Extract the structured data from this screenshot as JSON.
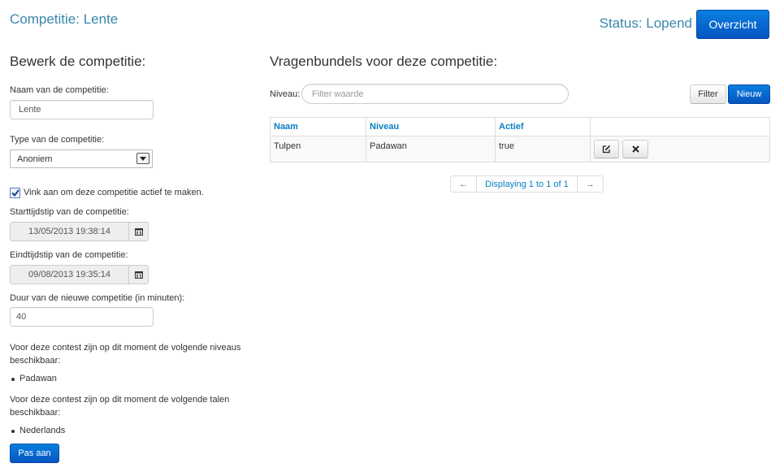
{
  "header": {
    "title": "Competitie: Lente",
    "status": "Status: Lopend",
    "overview_button": "Overzicht"
  },
  "form": {
    "heading": "Bewerk de competitie:",
    "name_label": "Naam van de competitie:",
    "name_value": "Lente",
    "type_label": "Type van de competitie:",
    "type_value": "Anoniem",
    "active_label": "Vink aan om deze competitie actief te maken.",
    "active_checked": true,
    "start_label": "Starttijdstip van de competitie:",
    "start_value": "13/05/2013 19:38:14",
    "end_label": "Eindtijdstip van de competitie:",
    "end_value": "09/08/2013 19:35:14",
    "duration_label": "Duur van de nieuwe competitie (in minuten):",
    "duration_value": "40",
    "levels_text": "Voor deze contest zijn op dit moment de volgende niveaus beschikbaar:",
    "levels": [
      "Padawan"
    ],
    "languages_text": "Voor deze contest zijn op dit moment de volgende talen beschikbaar:",
    "languages": [
      "Nederlands"
    ],
    "submit_button": "Pas aan"
  },
  "bundles": {
    "heading": "Vragenbundels voor deze competitie:",
    "filter_label": "Niveau:",
    "filter_placeholder": "Filter waarde",
    "filter_button": "Filter",
    "new_button": "Nieuw",
    "columns": [
      "Naam",
      "Niveau",
      "Actief",
      ""
    ],
    "rows": [
      {
        "naam": "Tulpen",
        "niveau": "Padawan",
        "actief": "true"
      }
    ],
    "pager": {
      "prev": "←",
      "info": "Displaying 1 to 1 of 1",
      "next": "→"
    }
  },
  "colors": {
    "accent": "#3a87ad",
    "primary_button": "#0555c0",
    "link": "#0a7fc4"
  },
  "icons": [
    "edit-icon",
    "delete-icon",
    "calendar-icon",
    "dropdown-arrow-icon",
    "checkmark-icon"
  ]
}
